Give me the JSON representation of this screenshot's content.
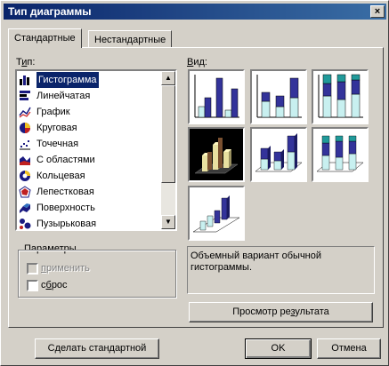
{
  "window": {
    "title": "Тип диаграммы",
    "close_glyph": "×"
  },
  "tabs": [
    {
      "label": "Стандартные",
      "active": true
    },
    {
      "label": "Нестандартные",
      "active": false
    }
  ],
  "type_label": {
    "pre": "Т",
    "ul": "и",
    "post": "п:"
  },
  "view_label": {
    "pre": "",
    "ul": "В",
    "post": "ид:"
  },
  "chart_types": [
    {
      "label": "Гистограмма",
      "icon": "column-chart-icon",
      "selected": true
    },
    {
      "label": "Линейчатая",
      "icon": "bar-chart-icon"
    },
    {
      "label": "График",
      "icon": "line-chart-icon"
    },
    {
      "label": "Круговая",
      "icon": "pie-chart-icon"
    },
    {
      "label": "Точечная",
      "icon": "scatter-chart-icon"
    },
    {
      "label": "С областями",
      "icon": "area-chart-icon"
    },
    {
      "label": "Кольцевая",
      "icon": "doughnut-chart-icon"
    },
    {
      "label": "Лепестковая",
      "icon": "radar-chart-icon"
    },
    {
      "label": "Поверхность",
      "icon": "surface-chart-icon"
    },
    {
      "label": "Пузырьковая",
      "icon": "bubble-chart-icon"
    }
  ],
  "params": {
    "title": "Параметры",
    "apply": {
      "pre": "",
      "ul": "п",
      "post": "рименить",
      "enabled": false
    },
    "reset": {
      "pre": "с",
      "ul": "б",
      "post": "рос",
      "enabled": true
    }
  },
  "description": "Объемный вариант обычной гистограммы.",
  "buttons": {
    "preview": {
      "pre": "Просмотр ре",
      "ul": "з",
      "post": "ультата"
    },
    "make_default": {
      "pre": "С",
      "ul": "д",
      "post": "елать стандартной"
    },
    "ok": "OK",
    "cancel": "Отмена"
  },
  "colors": {
    "bar_blue": "#33339a",
    "bar_light": "#c8f0f0",
    "bar_teal": "#209a9a",
    "selection": "#0a246a"
  }
}
